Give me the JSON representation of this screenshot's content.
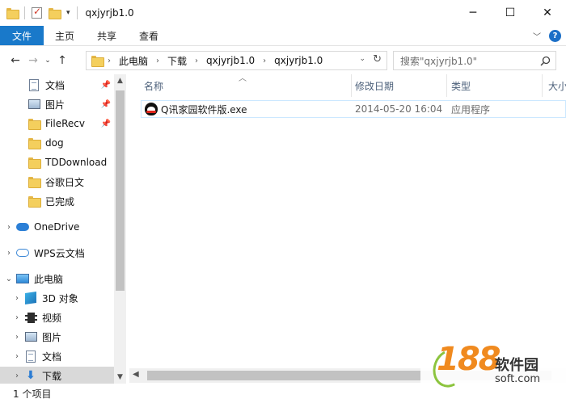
{
  "window": {
    "title": "qxjyrjb1.0",
    "controls": {
      "minimize": "─",
      "maximize": "☐",
      "close": "✕"
    }
  },
  "ribbon": {
    "tabs": [
      "文件",
      "主页",
      "共享",
      "查看"
    ],
    "help": "?"
  },
  "address": {
    "crumbs": [
      "此电脑",
      "下载",
      "qxjyrjb1.0",
      "qxjyrjb1.0"
    ]
  },
  "search": {
    "placeholder": "搜索\"qxjyrjb1.0\""
  },
  "nav": {
    "items": [
      {
        "label": "文档",
        "icon": "document-icon",
        "pinned": true
      },
      {
        "label": "图片",
        "icon": "picture-icon",
        "pinned": true
      },
      {
        "label": "FileRecv",
        "icon": "folder-icon",
        "pinned": true
      },
      {
        "label": "dog",
        "icon": "folder-icon",
        "pinned": false
      },
      {
        "label": "TDDownload",
        "icon": "folder-icon",
        "pinned": false
      },
      {
        "label": "谷歌日文",
        "icon": "folder-icon",
        "pinned": false
      },
      {
        "label": "已完成",
        "icon": "folder-icon",
        "pinned": false
      },
      {
        "label": "OneDrive",
        "icon": "onedrive-cloud-icon",
        "pinned": false
      },
      {
        "label": "WPS云文档",
        "icon": "wps-cloud-icon",
        "pinned": false
      },
      {
        "label": "此电脑",
        "icon": "computer-icon",
        "pinned": false
      },
      {
        "label": "3D 对象",
        "icon": "3d-objects-icon",
        "pinned": false
      },
      {
        "label": "视频",
        "icon": "video-icon",
        "pinned": false
      },
      {
        "label": "图片",
        "icon": "picture-icon",
        "pinned": false
      },
      {
        "label": "文档",
        "icon": "document-icon",
        "pinned": false
      },
      {
        "label": "下载",
        "icon": "download-arrow-icon",
        "pinned": false
      }
    ]
  },
  "columns": [
    "名称",
    "修改日期",
    "类型",
    "大小"
  ],
  "files": [
    {
      "name": "Q讯家园软件版.exe",
      "modified": "2014-05-20 16:04",
      "type": "应用程序",
      "icon": "qq-penguin-icon"
    }
  ],
  "status": {
    "count": "1 个项目"
  },
  "watermark": {
    "number": "188",
    "name": "软件园",
    "url": "soft.com"
  },
  "colors": {
    "accent": "#1979ca",
    "selection_border": "#cce8ff",
    "scroll_thumb": "#c2c2c2"
  }
}
